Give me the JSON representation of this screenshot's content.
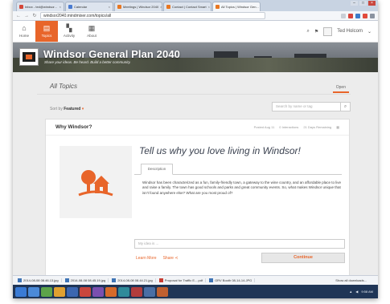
{
  "browser": {
    "tabs": [
      {
        "label": "Inbox - ted@windsor..."
      },
      {
        "label": "Calendar"
      },
      {
        "label": "Meetings | Windsor 2040"
      },
      {
        "label": "Contact | Contact Smart"
      },
      {
        "label": "All Topics | Windsor Gen..."
      }
    ],
    "active_tab": 4,
    "url": "windsor2040.mindmixer.com/topics/all"
  },
  "site_nav": {
    "items": [
      {
        "label": "Home",
        "icon": "home-icon"
      },
      {
        "label": "Topics",
        "icon": "topics-icon"
      },
      {
        "label": "Activity",
        "icon": "activity-icon"
      },
      {
        "label": "About",
        "icon": "about-icon"
      }
    ],
    "active_item": "Topics",
    "user_name": "Ted Holcom"
  },
  "banner": {
    "title": "Windsor General Plan 2040",
    "tagline": "Share your ideas. Be heard. Build a better community."
  },
  "topics": {
    "heading": "All Topics",
    "filter_tab": "Open",
    "sort_label": "Sort by",
    "sort_value": "Featured",
    "search_placeholder": "Search by name or tag"
  },
  "topic_card": {
    "question": "Why Windsor?",
    "posted": "Posted Aug 11",
    "interactions": "0 Interactions",
    "remaining": "21 Days Remaining",
    "prompt": "Tell us why you love living in Windsor!",
    "description_tab": "Description",
    "description": "Windsor has been characterized as a fun, family-friendly town, a gateway to the wine country, and an affordable place to live and raise a family. The town has good schools and parks and great community events. So, what makes Windsor unique that isn't found anywhere else? What are you most proud of?",
    "idea_placeholder": "My idea is ...",
    "learn_more": "Learn More",
    "share": "Share",
    "continue": "Continue"
  },
  "downloads": {
    "items": [
      {
        "name": "2014-08-08 08.46.13.jpg",
        "type": "image"
      },
      {
        "name": "2014-08-08 08.45.19.jpg",
        "type": "image"
      },
      {
        "name": "2014-08-08 08.44.21.jpg",
        "type": "image"
      },
      {
        "name": "Proposal for Traffic E....pdf",
        "type": "pdf"
      },
      {
        "name": "GRV Booth 08-14-14.JPG",
        "type": "image"
      }
    ],
    "show_all": "Show all downloads..."
  },
  "taskbar": {
    "clock": "9:58 AM"
  },
  "colors": {
    "accent": "#e8652a",
    "taskbar": "#1f3556"
  }
}
